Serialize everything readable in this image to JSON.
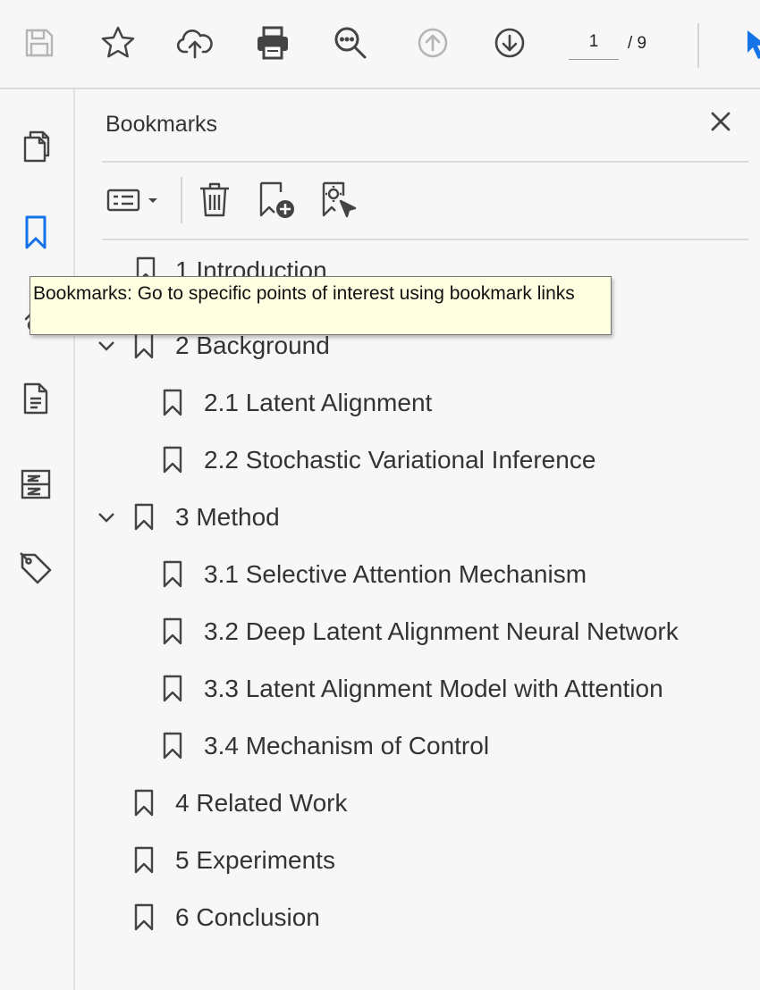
{
  "toolbar": {
    "icons": [
      "save-icon",
      "star-icon",
      "cloud-upload-icon",
      "print-icon",
      "zoom-icon",
      "page-up-icon",
      "page-down-icon",
      "select-cursor-icon"
    ],
    "current_page": "1",
    "total_pages": "/ 9"
  },
  "rail": {
    "icons": [
      "page-thumbnails-icon",
      "bookmarks-icon",
      "attachments-icon",
      "layers-icon",
      "order-icon",
      "tags-icon"
    ]
  },
  "panel": {
    "title": "Bookmarks",
    "tools": [
      "options-menu-icon",
      "delete-bookmark-icon",
      "new-bookmark-icon",
      "expand-bookmark-icon"
    ]
  },
  "bookmarks": [
    {
      "label": "1 Introduction",
      "level": 0,
      "expanded": null
    },
    {
      "label": "2 Background",
      "level": 0,
      "expanded": true
    },
    {
      "label": "2.1 Latent Alignment",
      "level": 1
    },
    {
      "label": "2.2 Stochastic Variational Inference",
      "level": 1
    },
    {
      "label": "3 Method",
      "level": 0,
      "expanded": true
    },
    {
      "label": "3.1 Selective Attention Mechanism",
      "level": 1
    },
    {
      "label": "3.2 Deep Latent Alignment Neural Network",
      "level": 1
    },
    {
      "label": "3.3 Latent Alignment Model with Attention",
      "level": 1
    },
    {
      "label": "3.4 Mechanism of Control",
      "level": 1
    },
    {
      "label": "4 Related Work",
      "level": 0
    },
    {
      "label": "5 Experiments",
      "level": 0
    },
    {
      "label": "6 Conclusion",
      "level": 0
    }
  ],
  "tooltip": {
    "text": "Bookmarks: Go to specific points of interest using bookmark links"
  },
  "colors": {
    "accent": "#1473e6",
    "icon": "#444444",
    "tooltip_bg": "#ffffe1"
  }
}
